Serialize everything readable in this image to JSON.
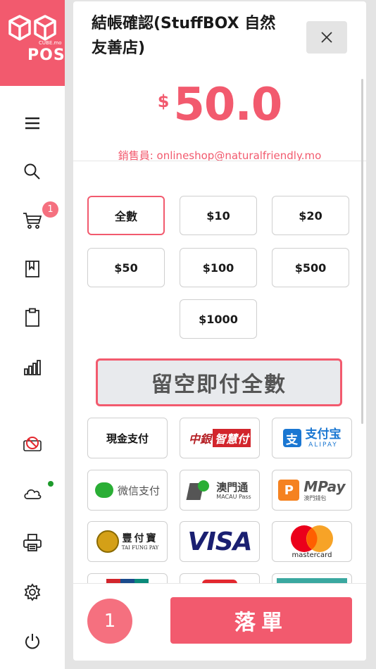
{
  "sidebar": {
    "logo": {
      "small_text": "CUBE.mo",
      "big_text": "POS"
    },
    "items": [
      {
        "name": "menu-icon"
      },
      {
        "name": "search-icon"
      },
      {
        "name": "cart-icon",
        "badge": "1"
      },
      {
        "name": "bookmark-icon"
      },
      {
        "name": "clipboard-icon"
      },
      {
        "name": "chart-icon"
      },
      {
        "name": "offline-icon"
      },
      {
        "name": "cloud-icon",
        "status": "online"
      },
      {
        "name": "printer-icon"
      },
      {
        "name": "gear-icon"
      },
      {
        "name": "power-icon"
      }
    ]
  },
  "dialog": {
    "title": "結帳確認(StuffBOX 自然友善店)",
    "currency": "$",
    "amount": "50.0",
    "seller": "銷售員: onlineshop@naturalfriendly.mo",
    "quick_amounts": [
      "全數",
      "$10",
      "$20",
      "$50",
      "$100",
      "$500",
      "$1000"
    ],
    "pay_all_label": "留空即付全數",
    "payment_methods": {
      "cash": "現金支付",
      "boc_cn": "中銀",
      "boc_brand": "智慧付",
      "alipay_cn": "支付宝",
      "alipay_en": "ALIPAY",
      "wechat": "微信支付",
      "macaupass_cn": "澳門通",
      "macaupass_en": "MACAU Pass",
      "mpay": "MPay",
      "mpay_cn": "澳門錢包",
      "taifung_cn": "豐付寶",
      "taifung_en": "TAI FUNG PAY",
      "visa": "VISA",
      "mastercard": "mastercard"
    },
    "footer": {
      "count": "1",
      "submit_label": "落單"
    }
  },
  "colors": {
    "accent": "#f25a6e",
    "badge": "#f5707f",
    "online": "#1d9a2b"
  }
}
